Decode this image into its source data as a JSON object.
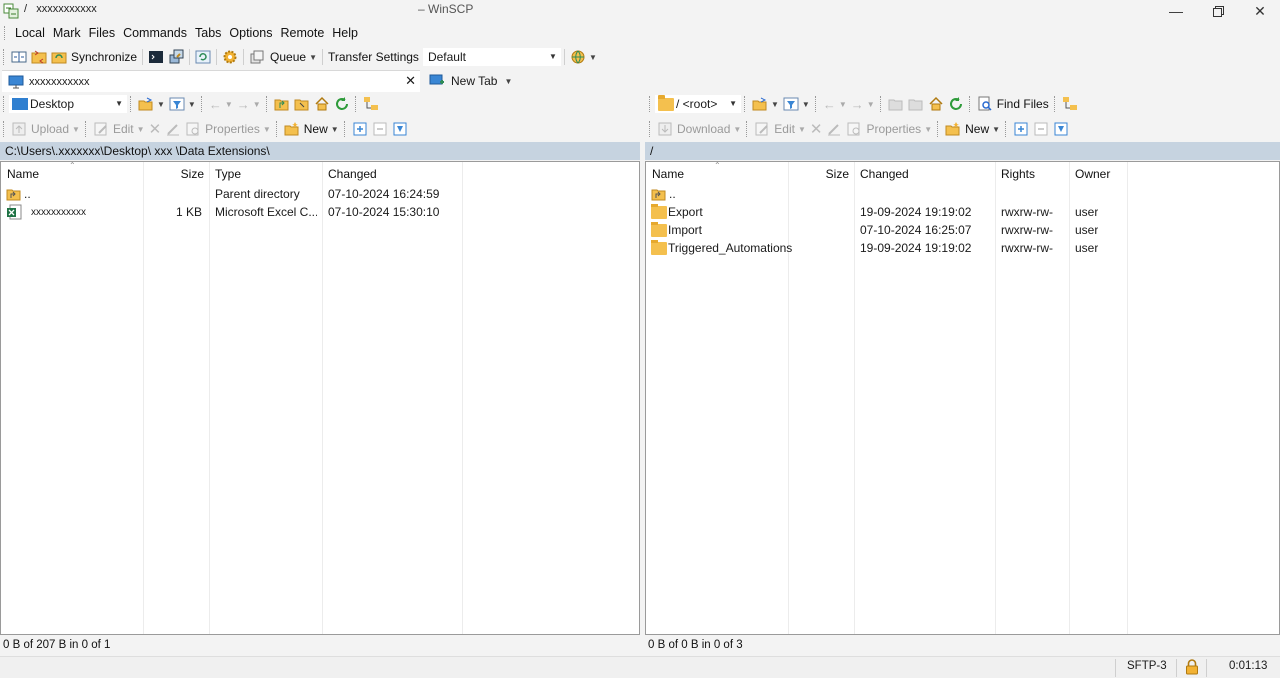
{
  "window": {
    "path_prefix": "/",
    "host_name": "xxxxxxxxxxx",
    "title": "– WinSCP"
  },
  "menu": [
    "Local",
    "Mark",
    "Files",
    "Commands",
    "Tabs",
    "Options",
    "Remote",
    "Help"
  ],
  "toolbar": {
    "synchronize_label": "Synchronize",
    "queue_label": "Queue",
    "transfer_settings_label": "Transfer Settings",
    "transfer_settings_value": "Default"
  },
  "tabs": {
    "session_tab": "xxxxxxxxxxx",
    "new_tab": "New Tab"
  },
  "local": {
    "location": "Desktop",
    "path": "C:\\Users\\.xxxxxxx\\Desktop\\  xxx  \\Data Extensions\\",
    "actions": {
      "upload": "Upload",
      "edit": "Edit",
      "properties": "Properties",
      "new": "New"
    },
    "columns": [
      "Name",
      "Size",
      "Type",
      "Changed"
    ],
    "rows": [
      {
        "name": "..",
        "size": "",
        "type": "Parent directory",
        "changed": "07-10-2024 16:24:59",
        "icon": "parent-folder-icon"
      },
      {
        "name": "xxxxxxxxxxx",
        "size": "1 KB",
        "type": "Microsoft Excel C...",
        "changed": "07-10-2024 15:30:10",
        "icon": "excel-file-icon"
      }
    ],
    "status": "0 B of 207 B in 0 of 1"
  },
  "remote": {
    "location": "/ <root>",
    "path": "/",
    "find_files_label": "Find Files",
    "actions": {
      "download": "Download",
      "edit": "Edit",
      "properties": "Properties",
      "new": "New"
    },
    "columns": [
      "Name",
      "Size",
      "Changed",
      "Rights",
      "Owner"
    ],
    "rows": [
      {
        "name": "..",
        "size": "",
        "changed": "",
        "rights": "",
        "owner": "",
        "icon": "parent-folder-icon"
      },
      {
        "name": "Export",
        "size": "",
        "changed": "19-09-2024 19:19:02",
        "rights": "rwxrw-rw-",
        "owner": "user",
        "icon": "folder-icon"
      },
      {
        "name": "Import",
        "size": "",
        "changed": "07-10-2024 16:25:07",
        "rights": "rwxrw-rw-",
        "owner": "user",
        "icon": "folder-icon"
      },
      {
        "name": "Triggered_Automations",
        "size": "",
        "changed": "19-09-2024 19:19:02",
        "rights": "rwxrw-rw-",
        "owner": "user",
        "icon": "folder-icon"
      }
    ],
    "status": "0 B of 0 B in 0 of 3"
  },
  "statusbar": {
    "protocol": "SFTP-3",
    "elapsed": "0:01:13"
  },
  "colors": {
    "path_bar": "#c6d3e0",
    "folder": "#f4c04e",
    "excel": "#1f7244"
  }
}
